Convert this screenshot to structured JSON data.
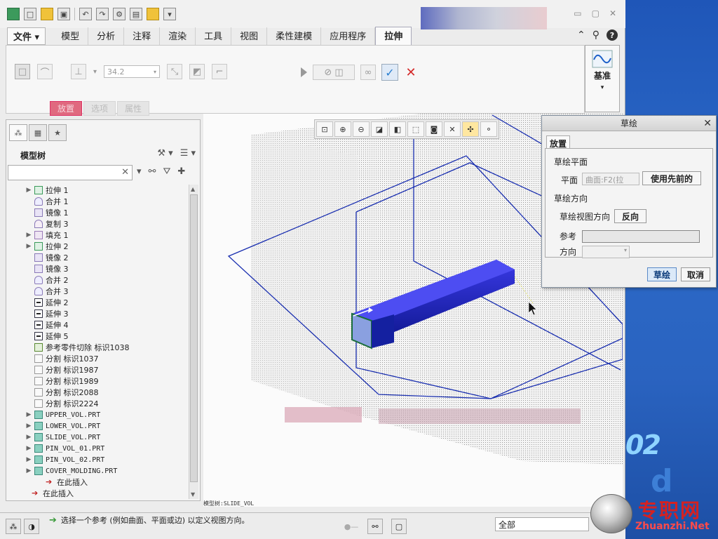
{
  "quick_access": {
    "icons": [
      "app-icon",
      "new-icon",
      "open-icon",
      "save-icon",
      "undo-icon",
      "redo-icon",
      "regenerate-icon",
      "windows-icon",
      "folder-icon"
    ]
  },
  "menu": {
    "file": "文件",
    "tabs": [
      "模型",
      "分析",
      "注释",
      "渲染",
      "工具",
      "视图",
      "柔性建模",
      "应用程序"
    ],
    "active_tab": "拉伸"
  },
  "ribbon": {
    "depth_value": "34.2",
    "sub_tabs": [
      "放置",
      "选项",
      "属性"
    ],
    "datum_label": "基准"
  },
  "model_tree": {
    "title": "模型树",
    "items": [
      {
        "label": "拉伸 1",
        "icon": "ext",
        "expand": true
      },
      {
        "label": "合并 1",
        "icon": "merge",
        "expand": false
      },
      {
        "label": "镜像 1",
        "icon": "mirror",
        "expand": false
      },
      {
        "label": "复制 3",
        "icon": "copy",
        "expand": false
      },
      {
        "label": "填充 1",
        "icon": "fill",
        "expand": true
      },
      {
        "label": "拉伸 2",
        "icon": "ext",
        "expand": true
      },
      {
        "label": "镜像 2",
        "icon": "mirror",
        "expand": false
      },
      {
        "label": "镜像 3",
        "icon": "mirror",
        "expand": false
      },
      {
        "label": "合并 2",
        "icon": "merge",
        "expand": false
      },
      {
        "label": "合并 3",
        "icon": "merge",
        "expand": false
      },
      {
        "label": "延伸 2",
        "icon": "extend",
        "expand": false
      },
      {
        "label": "延伸 3",
        "icon": "extend",
        "expand": false
      },
      {
        "label": "延伸 4",
        "icon": "extend",
        "expand": false
      },
      {
        "label": "延伸 5",
        "icon": "extend",
        "expand": false
      },
      {
        "label": "参考零件切除 标识1038",
        "icon": "cut",
        "expand": false
      },
      {
        "label": "分割 标识1037",
        "icon": "split",
        "expand": false
      },
      {
        "label": "分割 标识1987",
        "icon": "split",
        "expand": false
      },
      {
        "label": "分割 标识1989",
        "icon": "split",
        "expand": false
      },
      {
        "label": "分割 标识2088",
        "icon": "split",
        "expand": false
      },
      {
        "label": "分割 标识2224",
        "icon": "split",
        "expand": false
      },
      {
        "label": "UPPER_VOL.PRT",
        "icon": "part",
        "expand": true,
        "mono": true
      },
      {
        "label": "LOWER_VOL.PRT",
        "icon": "part",
        "expand": true,
        "mono": true
      },
      {
        "label": "SLIDE_VOL.PRT",
        "icon": "part",
        "expand": true,
        "mono": true
      },
      {
        "label": "PIN_VOL_01.PRT",
        "icon": "part",
        "expand": true,
        "mono": true
      },
      {
        "label": "PIN_VOL_02.PRT",
        "icon": "part",
        "expand": true,
        "mono": true
      },
      {
        "label": "COVER_MOLDING.PRT",
        "icon": "part",
        "expand": true,
        "mono": true
      },
      {
        "label": "在此插入",
        "icon": "insert",
        "expand": false,
        "indent": true
      },
      {
        "label": "在此插入",
        "icon": "insert",
        "expand": false,
        "indent": false,
        "outer": true
      }
    ]
  },
  "viewport": {
    "model_label": "模型树:SLIDE_VOL",
    "toolbar_icons": [
      "zoom-fit-icon",
      "zoom-in-icon",
      "zoom-out-icon",
      "repaint-icon",
      "shading-icon",
      "named-views-icon",
      "saved-orient-icon",
      "datum-display-icon",
      "spin-center-icon",
      "annotation-icon",
      "point-display-icon"
    ]
  },
  "sketch_dialog": {
    "title": "草绘",
    "tab": "放置",
    "sketch_plane_header": "草绘平面",
    "plane_label": "平面",
    "plane_value": "曲面:F2(拉",
    "use_previous": "使用先前的",
    "orientation_header": "草绘方向",
    "view_direction_label": "草绘视图方向",
    "flip_button": "反向",
    "reference_label": "参考",
    "direction_label": "方向",
    "sketch_button": "草绘",
    "cancel_button": "取消"
  },
  "status": {
    "message": "选择一个参考 (例如曲面、平面或边) 以定义视图方向。",
    "filter": "全部"
  },
  "desktop": {
    "number": "02",
    "watermark_cn": "专职网",
    "watermark_en": "Zhuanzhi.Net"
  },
  "colors": {
    "accent_blue": "#1a2fb0",
    "active_subtab": "#e0697f",
    "desktop_blue": "#2a63c0"
  }
}
